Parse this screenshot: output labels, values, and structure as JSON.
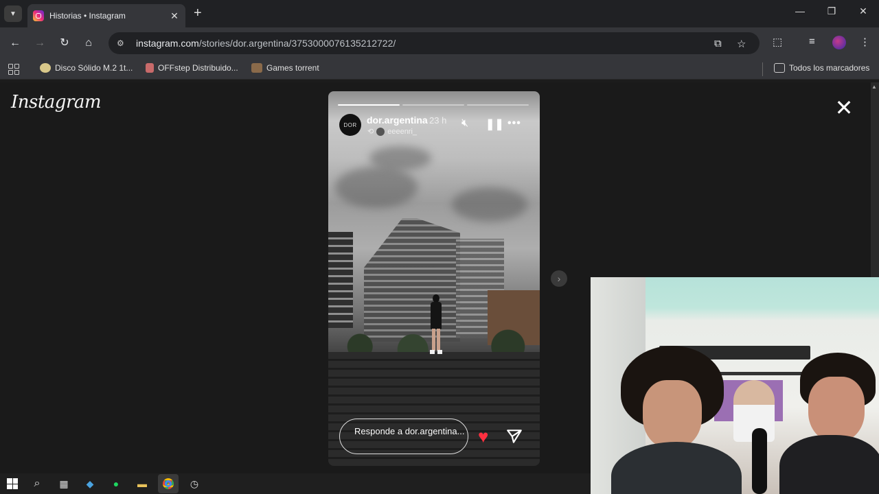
{
  "browser": {
    "tab_title": "Historias • Instagram",
    "url_host": "instagram.com",
    "url_path": "/stories/dor.argentina/3753000076135212722/",
    "bookmarks": [
      {
        "label": "Disco Sólido M.2 1t..."
      },
      {
        "label": "OFFstep Distribuido..."
      },
      {
        "label": "Games torrent"
      }
    ],
    "all_bookmarks_label": "Todos los marcadores"
  },
  "page": {
    "logo": "Instagram",
    "close_symbol": "✕"
  },
  "story": {
    "username": "dor.argentina",
    "time_ago": "23 h",
    "avatar_text": "DOR",
    "repost_user": "eeeenri_",
    "progress_segments": 3,
    "active_segment": 1,
    "reply_placeholder": "Responde a dor.argentina...",
    "colors": {
      "like": "#ff3040"
    }
  }
}
